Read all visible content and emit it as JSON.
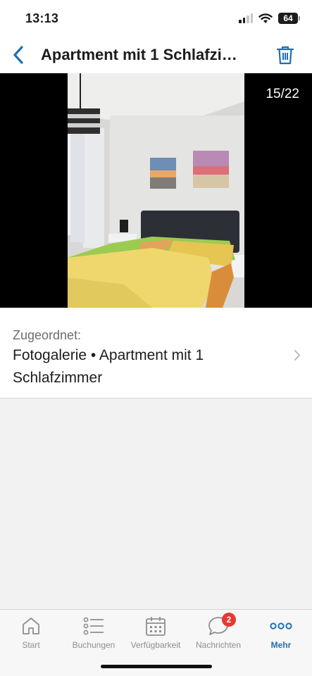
{
  "status_bar": {
    "time": "13:13",
    "battery": "64"
  },
  "nav": {
    "title": "Apartment mit 1 Schlafzi…"
  },
  "viewer": {
    "counter": "15/22"
  },
  "assignment": {
    "label": "Zugeordnet:",
    "value": "Fotogalerie • Apartment mit 1 Schlafzimmer"
  },
  "tabs": [
    {
      "label": "Start",
      "icon": "home-icon",
      "active": false
    },
    {
      "label": "Buchungen",
      "icon": "list-icon",
      "active": false
    },
    {
      "label": "Verfügbarkeit",
      "icon": "calendar-icon",
      "active": false
    },
    {
      "label": "Nachrichten",
      "icon": "chat-icon",
      "active": false,
      "badge": "2"
    },
    {
      "label": "Mehr",
      "icon": "more-icon",
      "active": true
    }
  ],
  "colors": {
    "accent": "#1f6fb5",
    "badge": "#e8392f",
    "viewer_bg": "#000000"
  }
}
